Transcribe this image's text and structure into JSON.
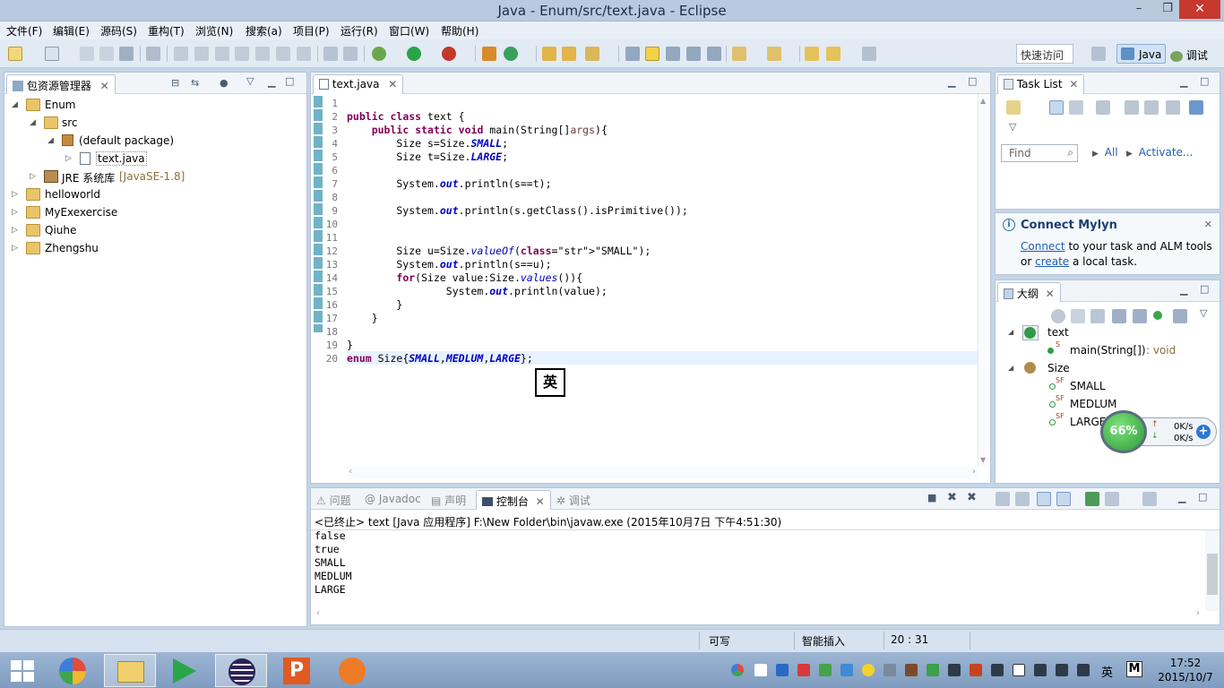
{
  "window": {
    "title": "Java - Enum/src/text.java - Eclipse",
    "min": "–",
    "max": "❐",
    "close": "✕"
  },
  "menu": [
    "文件(F)",
    "编辑(E)",
    "源码(S)",
    "重构(T)",
    "浏览(N)",
    "搜索(a)",
    "项目(P)",
    "运行(R)",
    "窗口(W)",
    "帮助(H)"
  ],
  "toolbar": {
    "quick_access": "快速访问",
    "perspective_java": "Java",
    "perspective_debug": "调试"
  },
  "explorer": {
    "tab": "包资源管理器",
    "tree": [
      {
        "label": "Enum",
        "kind": "project",
        "toggle": "◢"
      },
      {
        "label": "src",
        "kind": "folder",
        "toggle": "◢"
      },
      {
        "label": "(default package)",
        "kind": "package",
        "toggle": "◢"
      },
      {
        "label": "text.java",
        "kind": "file",
        "toggle": "▷"
      },
      {
        "label": "JRE 系统库",
        "suffix": "[JavaSE-1.8]",
        "kind": "library",
        "toggle": "▷"
      },
      {
        "label": "helloworld",
        "kind": "project",
        "toggle": "▷"
      },
      {
        "label": "MyExexercise",
        "kind": "project",
        "toggle": "▷"
      },
      {
        "label": "Qiuhe",
        "kind": "project",
        "toggle": "▷"
      },
      {
        "label": "Zhengshu",
        "kind": "project",
        "toggle": "▷"
      }
    ]
  },
  "editor": {
    "tab": "text.java",
    "ime_indicator": "英",
    "line_numbers": [
      "1",
      "2",
      "3",
      "4",
      "5",
      "6",
      "7",
      "8",
      "9",
      "10",
      "11",
      "12",
      "13",
      "14",
      "15",
      "16",
      "17",
      "18",
      "19",
      "20"
    ],
    "lines": [
      "",
      "public class text {",
      "    public static void main(String[]args){",
      "        Size s=Size.SMALL;",
      "        Size t=Size.LARGE;",
      "",
      "        System.out.println(s==t);",
      "",
      "        System.out.println(s.getClass().isPrimitive());",
      "",
      "",
      "        Size u=Size.valueOf(\"SMALL\");",
      "        System.out.println(s==u);",
      "        for(Size value:Size.values()){",
      "                System.out.println(value);",
      "        }",
      "    }",
      "",
      "}",
      "enum Size{SMALL,MEDLUM,LARGE};"
    ]
  },
  "tasklist": {
    "tab": "Task List",
    "find_placeholder": "Find",
    "all": "All",
    "activate": "Activate..."
  },
  "mylyn": {
    "title": "Connect Mylyn",
    "connect": "Connect",
    "text1": " to your task and ALM tools",
    "or": "or ",
    "create": "create",
    "text2": " a local task."
  },
  "outline": {
    "tab": "大纲",
    "items": [
      {
        "label": "text",
        "level": 0
      },
      {
        "label": "main(String[])",
        "suffix": " : void",
        "level": 1,
        "mark": "S"
      },
      {
        "label": "Size",
        "level": 0
      },
      {
        "label": "SMALL",
        "level": 1,
        "mark": "SF"
      },
      {
        "label": "MEDLUM",
        "level": 1,
        "mark": "SF"
      },
      {
        "label": "LARGE",
        "level": 1,
        "mark": "SF"
      }
    ]
  },
  "bottom": {
    "tabs": [
      "问题",
      "Javadoc",
      "声明",
      "控制台",
      "调试"
    ],
    "active_tab": "控制台",
    "console_header": "<已终止> text [Java 应用程序] F:\\New Folder\\bin\\javaw.exe (2015年10月7日 下午4:51:30)",
    "output": [
      "false",
      "true",
      "SMALL",
      "MEDLUM",
      "LARGE"
    ]
  },
  "status": {
    "writable": "可写",
    "insert_mode": "智能插入",
    "position": "20 : 31"
  },
  "speed_widget": {
    "percent": "66%",
    "up": "0K/s",
    "down": "0K/s"
  },
  "taskbar": {
    "time": "17:52",
    "date": "2015/10/7",
    "ime": "英",
    "ime2": "M"
  }
}
